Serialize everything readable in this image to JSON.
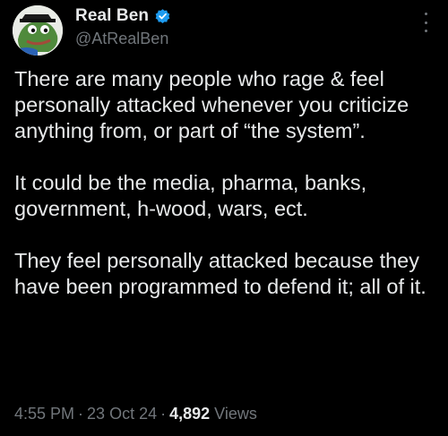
{
  "author": {
    "display_name": "Real Ben",
    "handle": "@AtRealBen",
    "verified": true
  },
  "tweet": {
    "paragraphs": [
      "There are many people who rage & feel personally attacked whenever you criticize anything from, or part of “the system”.",
      "It could be the media, pharma, banks, government, h-wood, wars, ect.",
      "They feel personally attacked because they have been programmed to defend it; all of it."
    ],
    "time": "4:55 PM",
    "date": "23 Oct 24",
    "separator": "·",
    "views_count": "4,892",
    "views_label": "Views"
  },
  "icons": {
    "verified": "verified-badge-icon",
    "more": "more-options-icon"
  },
  "colors": {
    "background": "#000000",
    "text_primary": "#e7e9ea",
    "text_secondary": "#71767b",
    "verified_blue": "#1d9bf0"
  }
}
